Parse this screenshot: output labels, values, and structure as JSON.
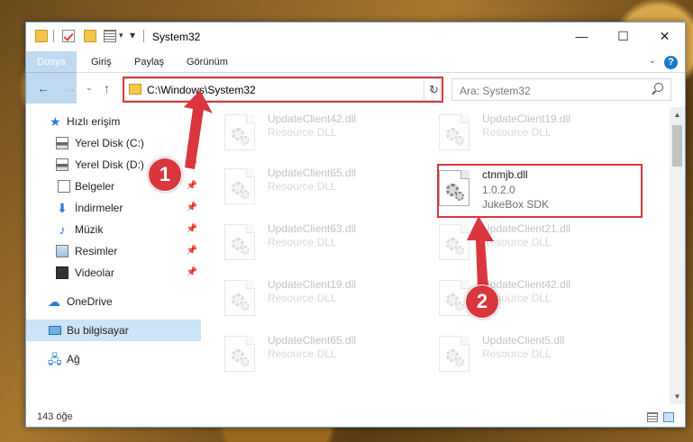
{
  "window": {
    "title": "System32"
  },
  "ribbon": {
    "tabs": [
      "Dosya",
      "Giriş",
      "Paylaş",
      "Görünüm"
    ],
    "help": "?"
  },
  "address": {
    "path": "C:\\Windows\\System32"
  },
  "search": {
    "placeholder": "Ara: System32"
  },
  "nav": {
    "items": [
      {
        "label": "Hızlı erişim",
        "icon": "star-icon"
      },
      {
        "label": "Yerel Disk (C:)",
        "icon": "disk-icon"
      },
      {
        "label": "Yerel Disk (D:)",
        "icon": "disk-icon"
      },
      {
        "label": "Belgeler",
        "icon": "documents-icon"
      },
      {
        "label": "İndirmeler",
        "icon": "download-icon"
      },
      {
        "label": "Müzik",
        "icon": "music-icon"
      },
      {
        "label": "Resimler",
        "icon": "pictures-icon"
      },
      {
        "label": "Videolar",
        "icon": "video-icon"
      },
      {
        "label": "OneDrive",
        "icon": "cloud-icon"
      },
      {
        "label": "Bu bilgisayar",
        "icon": "computer-icon"
      },
      {
        "label": "Ağ",
        "icon": "network-icon"
      }
    ]
  },
  "files": [
    {
      "name": "UpdateClient42.dll",
      "desc1": "Resource DLL",
      "desc2": ""
    },
    {
      "name": "UpdateClient19.dll",
      "desc1": "Resource DLL",
      "desc2": ""
    },
    {
      "name": "UpdateClient65.dll",
      "desc1": "Resource DLL",
      "desc2": ""
    },
    {
      "name": "ctnmjb.dll",
      "desc1": "1.0.2.0",
      "desc2": "JukeBox SDK"
    },
    {
      "name": "UpdateClient63.dll",
      "desc1": "Resource DLL",
      "desc2": ""
    },
    {
      "name": "UpdateClient21.dll",
      "desc1": "Resource DLL",
      "desc2": ""
    },
    {
      "name": "UpdateClient19.dll",
      "desc1": "Resource DLL",
      "desc2": ""
    },
    {
      "name": "UpdateClient42.dll",
      "desc1": "Resource DLL",
      "desc2": ""
    },
    {
      "name": "UpdateClient65.dll",
      "desc1": "Resource DLL",
      "desc2": ""
    },
    {
      "name": "UpdateClient5.dll",
      "desc1": "Resource DLL",
      "desc2": ""
    }
  ],
  "status": {
    "count": "143 öğe"
  },
  "annotations": {
    "step1": "1",
    "step2": "2",
    "color": "#d9363e"
  }
}
